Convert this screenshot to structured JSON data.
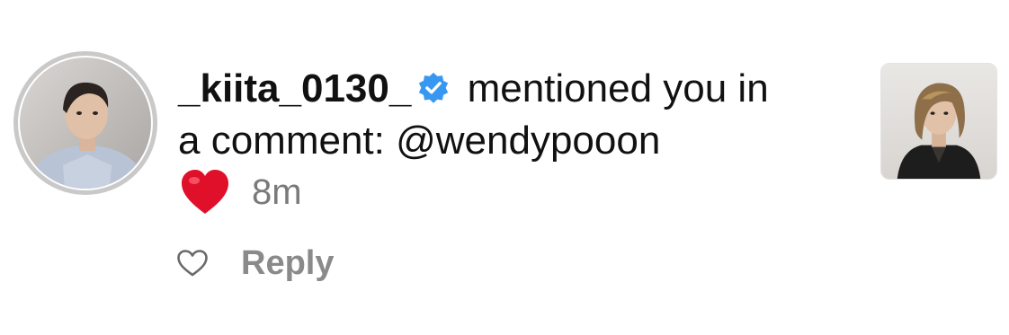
{
  "notification": {
    "username": "_kiita_0130_",
    "verified_icon": "verified-badge-icon",
    "message_line1": " mentioned you in",
    "message_line2": "a comment: @wendypooon",
    "reaction_emoji": "red-heart-emoji",
    "time": "8m",
    "like_icon": "heart-outline-icon",
    "reply_label": "Reply"
  },
  "colors": {
    "verified_blue": "#3897f0",
    "heart_red": "#e0102a",
    "muted_text": "#8a8a8a",
    "avatar_ring": "#c9c9c9"
  }
}
